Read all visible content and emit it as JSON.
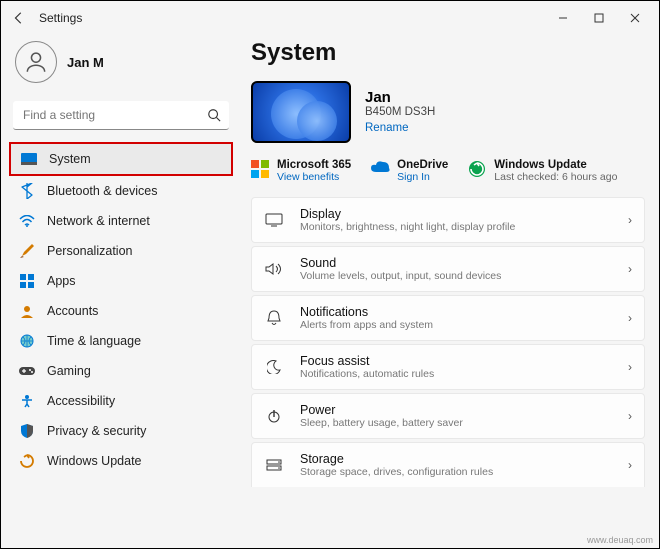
{
  "window": {
    "title": "Settings"
  },
  "user": {
    "name": "Jan M"
  },
  "search": {
    "placeholder": "Find a setting"
  },
  "sidebar": {
    "items": [
      {
        "label": "System"
      },
      {
        "label": "Bluetooth & devices"
      },
      {
        "label": "Network & internet"
      },
      {
        "label": "Personalization"
      },
      {
        "label": "Apps"
      },
      {
        "label": "Accounts"
      },
      {
        "label": "Time & language"
      },
      {
        "label": "Gaming"
      },
      {
        "label": "Accessibility"
      },
      {
        "label": "Privacy & security"
      },
      {
        "label": "Windows Update"
      }
    ]
  },
  "main": {
    "heading": "System",
    "pc": {
      "name": "Jan",
      "model": "B450M DS3H",
      "rename": "Rename"
    },
    "services": [
      {
        "title": "Microsoft 365",
        "sub": "View benefits"
      },
      {
        "title": "OneDrive",
        "sub": "Sign In"
      },
      {
        "title": "Windows Update",
        "sub": "Last checked: 6 hours ago"
      }
    ],
    "cards": [
      {
        "title": "Display",
        "sub": "Monitors, brightness, night light, display profile"
      },
      {
        "title": "Sound",
        "sub": "Volume levels, output, input, sound devices"
      },
      {
        "title": "Notifications",
        "sub": "Alerts from apps and system"
      },
      {
        "title": "Focus assist",
        "sub": "Notifications, automatic rules"
      },
      {
        "title": "Power",
        "sub": "Sleep, battery usage, battery saver"
      },
      {
        "title": "Storage",
        "sub": "Storage space, drives, configuration rules"
      }
    ]
  },
  "watermark": "www.deuaq.com"
}
